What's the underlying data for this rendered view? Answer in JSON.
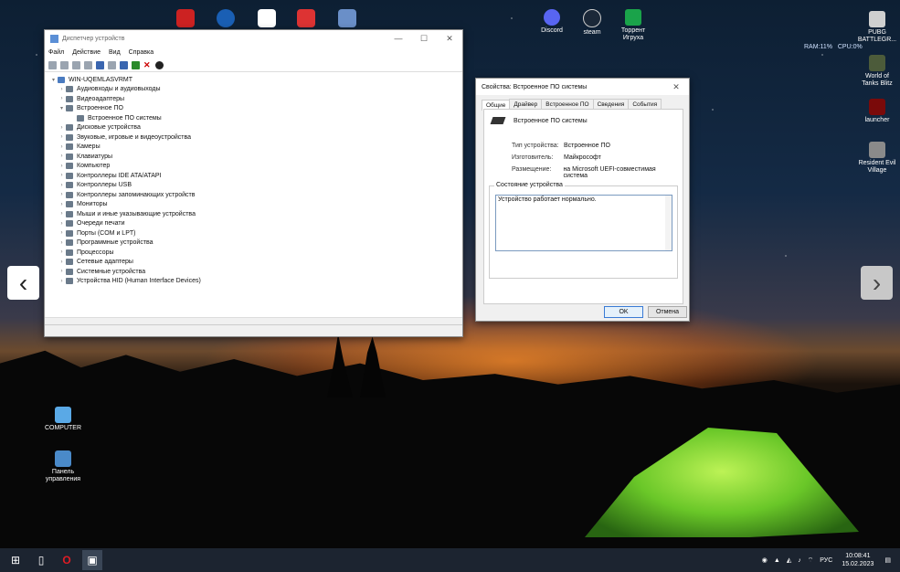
{
  "desktop": {
    "top_icons": [
      "Discord",
      "steam",
      "Торрент Игруха"
    ],
    "right_icons": [
      {
        "label": "PUBG BATTLEGR..."
      },
      {
        "label": "World of Tanks Blitz"
      },
      {
        "label": "launcher"
      },
      {
        "label": "Resident Evil Village"
      }
    ],
    "left_icons": [
      {
        "label": "COMPUTER"
      },
      {
        "label": "Панель управления"
      }
    ],
    "monitor": {
      "ram": "RAM:11%",
      "cpu": "CPU:0%"
    }
  },
  "device_manager": {
    "title": "Диспетчер устройств",
    "menu": [
      "Файл",
      "Действие",
      "Вид",
      "Справка"
    ],
    "root": "WIN-UQEMLASVRMT",
    "items": [
      {
        "label": "Аудиовходы и аудиовыходы",
        "expanded": false
      },
      {
        "label": "Видеоадаптеры",
        "expanded": false
      },
      {
        "label": "Встроенное ПО",
        "expanded": true,
        "children": [
          "Встроенное ПО системы"
        ]
      },
      {
        "label": "Дисковые устройства",
        "expanded": false
      },
      {
        "label": "Звуковые, игровые и видеоустройства",
        "expanded": false
      },
      {
        "label": "Камеры",
        "expanded": false
      },
      {
        "label": "Клавиатуры",
        "expanded": false
      },
      {
        "label": "Компьютер",
        "expanded": false
      },
      {
        "label": "Контроллеры IDE ATA/ATAPI",
        "expanded": false
      },
      {
        "label": "Контроллеры USB",
        "expanded": false
      },
      {
        "label": "Контроллеры запоминающих устройств",
        "expanded": false
      },
      {
        "label": "Мониторы",
        "expanded": false
      },
      {
        "label": "Мыши и иные указывающие устройства",
        "expanded": false
      },
      {
        "label": "Очереди печати",
        "expanded": false
      },
      {
        "label": "Порты (COM и LPT)",
        "expanded": false
      },
      {
        "label": "Программные устройства",
        "expanded": false
      },
      {
        "label": "Процессоры",
        "expanded": false
      },
      {
        "label": "Сетевые адаптеры",
        "expanded": false
      },
      {
        "label": "Системные устройства",
        "expanded": false
      },
      {
        "label": "Устройства HID (Human Interface Devices)",
        "expanded": false
      }
    ]
  },
  "properties": {
    "title": "Свойства: Встроенное ПО системы",
    "tabs": [
      "Общие",
      "Драйвер",
      "Встроенное ПО",
      "Сведения",
      "События"
    ],
    "active_tab": "Общие",
    "device_name": "Встроенное ПО системы",
    "fields": [
      {
        "key": "Тип устройства:",
        "value": "Встроенное ПО"
      },
      {
        "key": "Изготовитель:",
        "value": "Майкрософт"
      },
      {
        "key": "Размещение:",
        "value": "на Microsoft UEFI-совместимая система"
      }
    ],
    "status_group_label": "Состояние устройства",
    "status_text": "Устройство работает нормально.",
    "ok_label": "OK",
    "cancel_label": "Отмена"
  },
  "taskbar": {
    "lang": "РУС",
    "time": "10:08:41",
    "date": "15.02.2023"
  }
}
